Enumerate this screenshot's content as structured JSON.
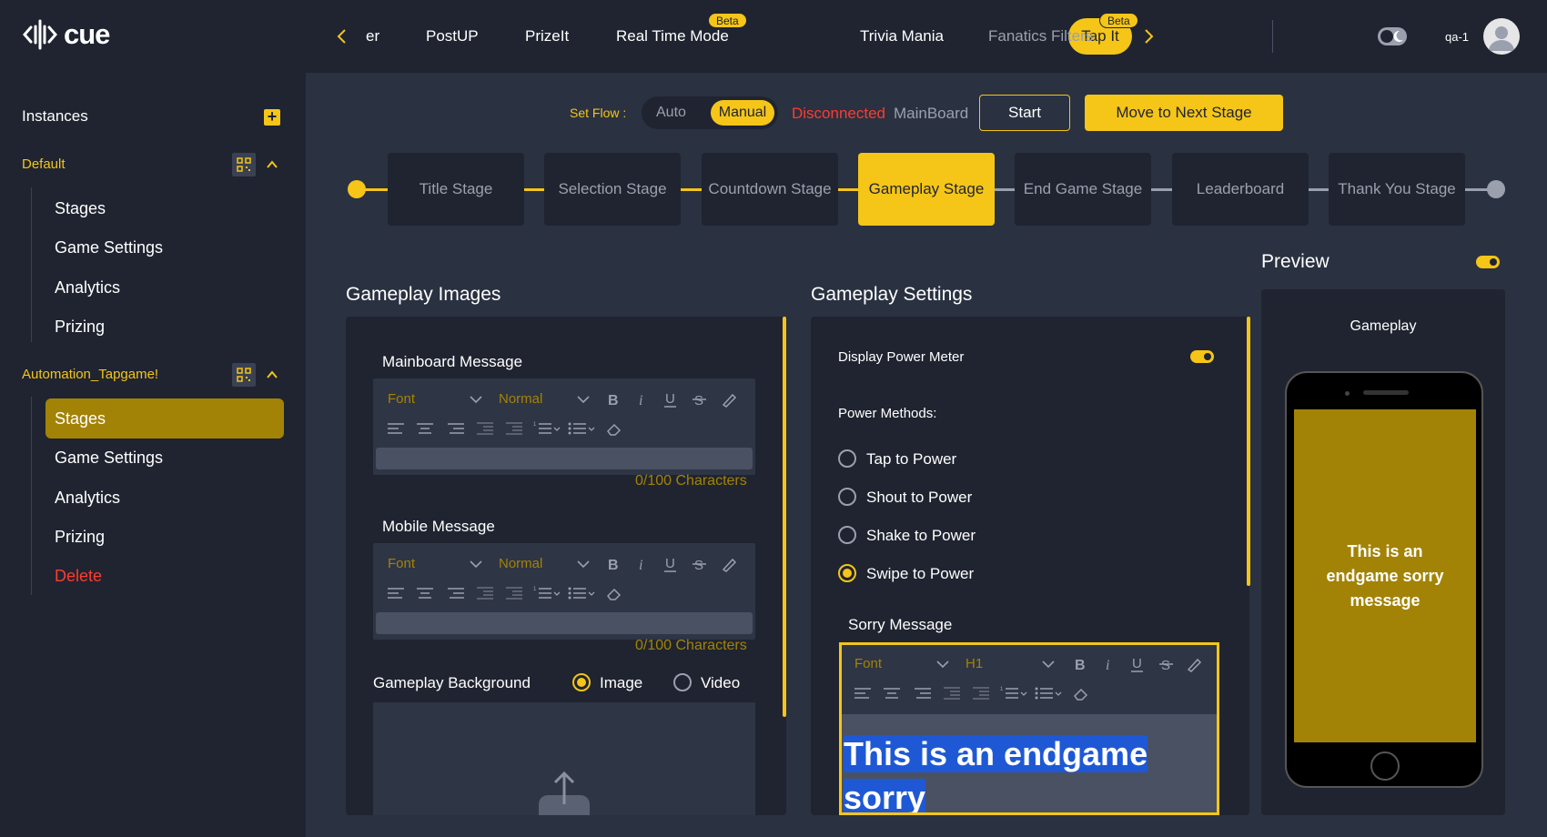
{
  "brand": {
    "logo_text": "cue"
  },
  "sidebar": {
    "title": "Instances",
    "groups": [
      {
        "name": "Default",
        "items": [
          "Stages",
          "Game Settings",
          "Analytics",
          "Prizing"
        ]
      },
      {
        "name": "Automation_Tapgame!",
        "items": [
          "Stages",
          "Game Settings",
          "Analytics",
          "Prizing",
          "Delete"
        ],
        "active_item": "Stages"
      }
    ]
  },
  "topnav": {
    "items": [
      "er",
      "PostUP",
      "PrizeIt",
      "Real Time Mode",
      "Tap It",
      "Trivia Mania",
      "Fanatics Filters"
    ],
    "active": "Tap It",
    "beta_label": "Beta",
    "user": "qa-1"
  },
  "flow": {
    "label": "Set Flow :",
    "options": [
      "Auto",
      "Manual"
    ],
    "selected": "Manual",
    "status": "Disconnected",
    "board": "MainBoard",
    "start_label": "Start",
    "next_label": "Move to Next Stage"
  },
  "stages": [
    "Title Stage",
    "Selection Stage",
    "Countdown Stage",
    "Gameplay Stage",
    "End Game Stage",
    "Leaderboard",
    "Thank You Stage"
  ],
  "active_stage": "Gameplay Stage",
  "images": {
    "title": "Gameplay Images",
    "mainboard_label": "Mainboard Message",
    "mobile_label": "Mobile Message",
    "char_count": "0/100 Characters",
    "font_placeholder": "Font",
    "size_placeholder": "Normal",
    "background_label": "Gameplay Background",
    "bg_options": [
      "Image",
      "Video"
    ],
    "bg_selected": "Image"
  },
  "settings": {
    "title": "Gameplay Settings",
    "power_meter_label": "Display Power Meter",
    "power_meter_on": true,
    "methods_label": "Power Methods:",
    "methods": [
      "Tap to Power",
      "Shout to Power",
      "Shake to Power",
      "Swipe to Power"
    ],
    "method_selected": "Swipe to Power",
    "sorry_label": "Sorry Message",
    "sorry_font": "Font",
    "sorry_size": "H1",
    "sorry_text_line1": "This is an endgame sorry",
    "sorry_text_line2": "message"
  },
  "preview": {
    "title": "Preview",
    "enabled": true,
    "screen_label": "Gameplay",
    "message": "This is an endgame sorry message"
  },
  "colors": {
    "accent": "#f5c518",
    "accent_dark": "#a38305",
    "danger": "#ff3b30",
    "panel": "#1f2430",
    "bg": "#2a3141"
  }
}
